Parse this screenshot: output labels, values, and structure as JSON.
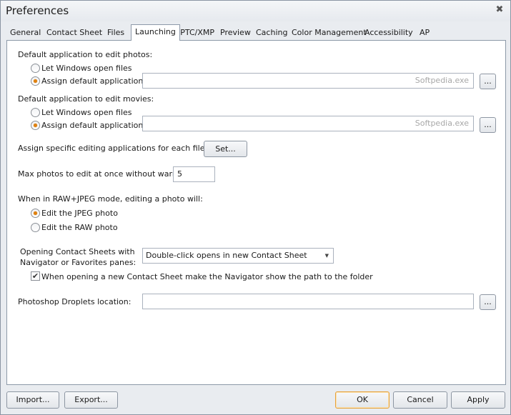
{
  "window": {
    "title": "Preferences",
    "close_glyph": "✖"
  },
  "tabs": [
    {
      "label": "General",
      "active": false
    },
    {
      "label": "Contact Sheet",
      "active": false
    },
    {
      "label": "Files",
      "active": false
    },
    {
      "label": "Launching",
      "active": true
    },
    {
      "label": "IPTC/XMP",
      "active": false
    },
    {
      "label": "Preview",
      "active": false
    },
    {
      "label": "Caching",
      "active": false
    },
    {
      "label": "Color Management",
      "active": false
    },
    {
      "label": "Accessibility",
      "active": false
    },
    {
      "label": "AP",
      "active": false
    }
  ],
  "photos": {
    "heading": "Default application to edit photos:",
    "opt_windows": "Let Windows open files",
    "opt_assign": "Assign default application:",
    "selected": "assign",
    "app_value": "Softpedia.exe",
    "browse_label": "..."
  },
  "movies": {
    "heading": "Default application to edit movies:",
    "opt_windows": "Let Windows open files",
    "opt_assign": "Assign default application:",
    "selected": "assign",
    "app_value": "Softpedia.exe",
    "browse_label": "..."
  },
  "filetype": {
    "label": "Assign specific editing applications for each file type:",
    "button": "Set..."
  },
  "max_photos": {
    "label": "Max photos to edit at once without warning:",
    "value": "5"
  },
  "raw_jpeg": {
    "heading": "When in RAW+JPEG mode, editing a photo will:",
    "opt_jpeg": "Edit the JPEG photo",
    "opt_raw": "Edit the RAW photo",
    "selected": "jpeg"
  },
  "contact_sheets": {
    "label_line1": "Opening Contact Sheets with",
    "label_line2": "Navigator or Favorites panes:",
    "selected_option": "Double-click opens in new Contact Sheet",
    "arrow_glyph": "▼",
    "checkbox_label": "When opening a new Contact Sheet make the Navigator show the path to the folder",
    "checkbox_checked": true,
    "check_glyph": "✔"
  },
  "droplets": {
    "label": "Photoshop Droplets location:",
    "value": "",
    "browse_label": "..."
  },
  "footer": {
    "import": "Import...",
    "export": "Export...",
    "ok": "OK",
    "cancel": "Cancel",
    "apply": "Apply"
  }
}
